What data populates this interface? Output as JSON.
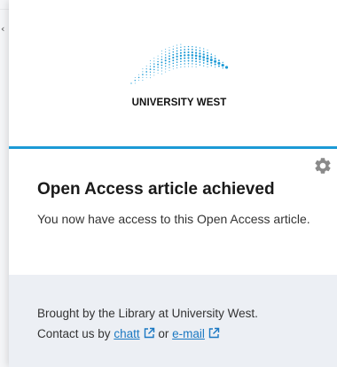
{
  "logo": {
    "text": "UNIVERSITY WEST",
    "brand_color": "#1c9ad6"
  },
  "settings": {
    "icon": "gear-icon"
  },
  "dialog": {
    "title": "Open Access article achieved",
    "message": "You now have access to this Open Access article."
  },
  "footer": {
    "line1": "Brought by the Library at University West.",
    "contact_prefix": "Contact us by",
    "chat_link": "chatt",
    "or_text": "or",
    "email_link": "e-mail",
    "link_icon": "external-link-icon",
    "background": "#eceff4"
  },
  "colors": {
    "accent": "#1c9ad6",
    "link": "#1a78c2"
  }
}
